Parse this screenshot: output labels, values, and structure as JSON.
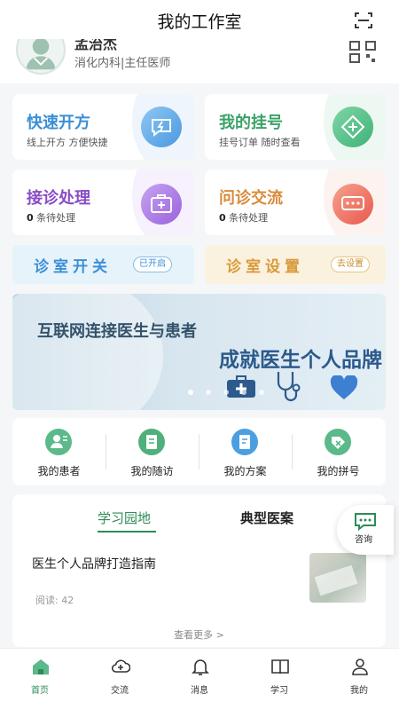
{
  "header": {
    "title": "我的工作室"
  },
  "profile": {
    "name": "孟治杰",
    "department": "消化内科|主任医师"
  },
  "service_cards": [
    {
      "title": "快速开方",
      "subtitle": "线上开方 方便快捷",
      "title_color": "#3a8fd6"
    },
    {
      "title": "我的挂号",
      "subtitle": "挂号订单 随时查看",
      "title_color": "#3aa266"
    },
    {
      "title": "接诊处理",
      "count": "0",
      "subtitle": "条待处理",
      "title_color": "#8a4cc7"
    },
    {
      "title": "问诊交流",
      "count": "0",
      "subtitle": "条待处理",
      "title_color": "#d98a3a"
    }
  ],
  "switches": {
    "clinic_switch": {
      "label": "诊室开关",
      "badge": "已开启"
    },
    "clinic_settings": {
      "label": "诊室设置",
      "badge": "去设置"
    }
  },
  "banner": {
    "line1": "互联网连接医生与患者",
    "line2": "成就医生个人品牌",
    "dot_count": 5,
    "active_dot": 0
  },
  "quick_menu": [
    {
      "label": "我的患者",
      "icon": "patient-icon"
    },
    {
      "label": "我的随访",
      "icon": "followup-icon"
    },
    {
      "label": "我的方案",
      "icon": "plan-icon"
    },
    {
      "label": "我的拼号",
      "icon": "group-booking-icon"
    }
  ],
  "learning": {
    "tabs": [
      {
        "label": "学习园地",
        "active": true
      },
      {
        "label": "典型医案",
        "active": false
      }
    ],
    "article": {
      "title": "医生个人品牌打造指南",
      "reads_label": "阅读:",
      "reads": "42"
    },
    "see_more": "查看更多 >"
  },
  "consult_button": {
    "label": "咨询"
  },
  "tabbar": [
    {
      "label": "首页",
      "icon": "home-icon",
      "active": true
    },
    {
      "label": "交流",
      "icon": "cloud-plus-icon",
      "active": false
    },
    {
      "label": "消息",
      "icon": "bell-icon",
      "active": false
    },
    {
      "label": "学习",
      "icon": "book-icon",
      "active": false
    },
    {
      "label": "我的",
      "icon": "user-icon",
      "active": false
    }
  ],
  "colors": {
    "accent": "#2e8b57",
    "background": "#f5f6f8"
  }
}
